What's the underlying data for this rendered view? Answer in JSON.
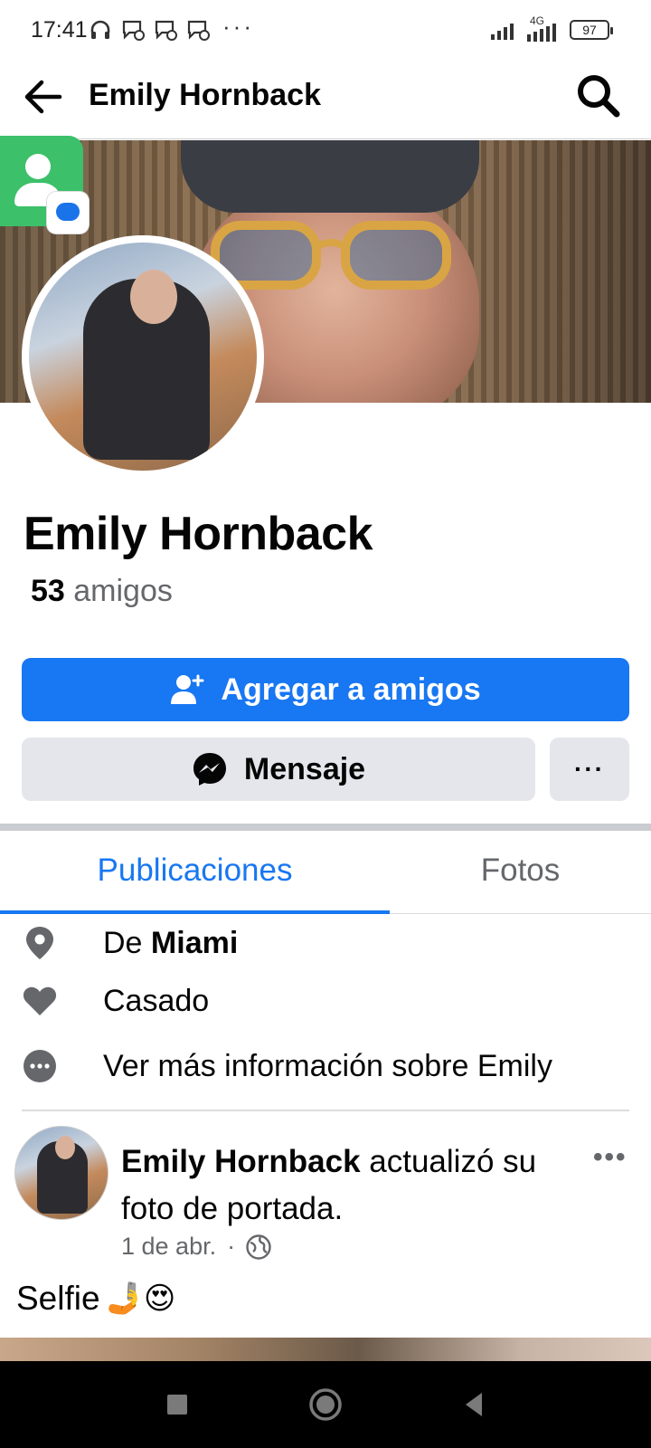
{
  "status_bar": {
    "time": "17:41",
    "overflow": "···",
    "network": "4G",
    "battery": "97"
  },
  "header": {
    "title": "Emily Hornback",
    "back_icon": "back-arrow-icon",
    "search_icon": "search-icon"
  },
  "profile": {
    "name": "Emily Hornback",
    "friends_count": "53",
    "friends_label": " amigos"
  },
  "actions": {
    "add_friend_label": "Agregar a amigos",
    "message_label": "Mensaje",
    "more_label": "···"
  },
  "tabs": [
    {
      "label": "Publicaciones",
      "active": true
    },
    {
      "label": "Fotos",
      "active": false
    }
  ],
  "intro": {
    "from_prefix": "De ",
    "from_city": "Miami",
    "relationship": "Casado",
    "see_more": "Ver más información sobre Emily"
  },
  "post": {
    "author": "Emily Hornback",
    "action_text": " actualizó su foto de portada.",
    "date": "1 de abr.",
    "separator": "·",
    "menu": "•••",
    "caption": "Selfie",
    "caption_emojis": "🤳😍"
  },
  "colors": {
    "brand_blue": "#1877f2",
    "secondary_button": "#e4e6eb",
    "muted_text": "#65676b"
  }
}
